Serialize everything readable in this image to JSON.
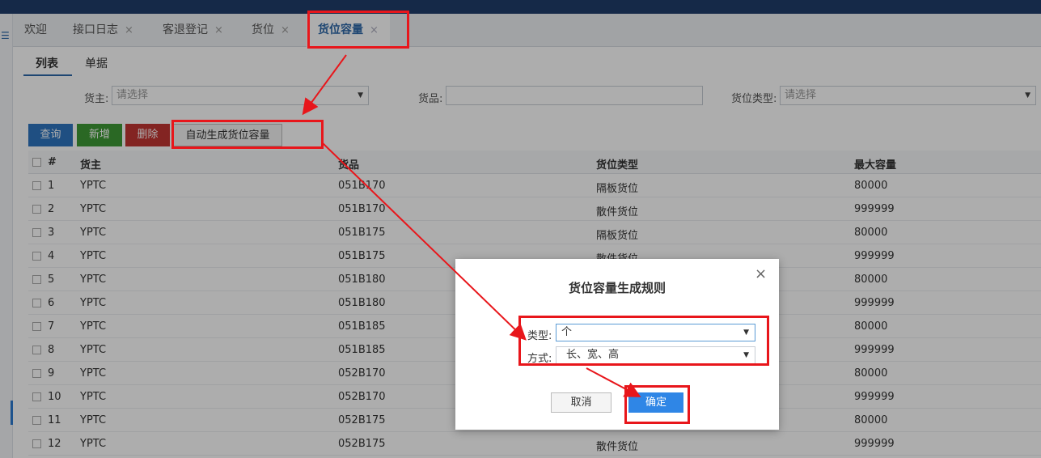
{
  "tabs": [
    {
      "label": "欢迎",
      "closable": false
    },
    {
      "label": "接口日志",
      "closable": true
    },
    {
      "label": "客退登记",
      "closable": true
    },
    {
      "label": "货位",
      "closable": true
    },
    {
      "label": "货位容量",
      "closable": true,
      "active": true
    }
  ],
  "tab_close": "×",
  "subtabs": [
    "列表",
    "单据"
  ],
  "filters": {
    "owner_label": "货主:",
    "owner_placeholder": "请选择",
    "goods_label": "货品:",
    "goods_value": "",
    "slot_type_label": "货位类型:",
    "slot_type_placeholder": "请选择"
  },
  "toolbar": {
    "query": "查询",
    "add": "新增",
    "delete": "删除",
    "auto_generate": "自动生成货位容量"
  },
  "table": {
    "headers": [
      "#",
      "货主",
      "货品",
      "货位类型",
      "最大容量"
    ],
    "rows": [
      [
        "1",
        "YPTC",
        "051B170",
        "隔板货位",
        "80000"
      ],
      [
        "2",
        "YPTC",
        "051B170",
        "散件货位",
        "999999"
      ],
      [
        "3",
        "YPTC",
        "051B175",
        "隔板货位",
        "80000"
      ],
      [
        "4",
        "YPTC",
        "051B175",
        "散件货位",
        "999999"
      ],
      [
        "5",
        "YPTC",
        "051B180",
        "",
        "80000"
      ],
      [
        "6",
        "YPTC",
        "051B180",
        "",
        "999999"
      ],
      [
        "7",
        "YPTC",
        "051B185",
        "",
        "80000"
      ],
      [
        "8",
        "YPTC",
        "051B185",
        "",
        "999999"
      ],
      [
        "9",
        "YPTC",
        "052B170",
        "",
        "80000"
      ],
      [
        "10",
        "YPTC",
        "052B170",
        "",
        "999999"
      ],
      [
        "11",
        "YPTC",
        "052B175",
        "",
        "80000"
      ],
      [
        "12",
        "YPTC",
        "052B175",
        "散件货位",
        "999999"
      ]
    ]
  },
  "dialog": {
    "title": "货位容量生成规则",
    "close": "×",
    "type_label": "类型:",
    "type_value": "个",
    "method_label": "方式:",
    "method_value": "长、宽、高",
    "cancel": "取消",
    "ok": "确定"
  },
  "colors": {
    "accent": "#2d68a8",
    "query_btn": "#2f75c0",
    "add_btn": "#3f9a36",
    "delete_btn": "#c23533",
    "ok_btn": "#2f86e6",
    "annotation": "#e8161b"
  }
}
